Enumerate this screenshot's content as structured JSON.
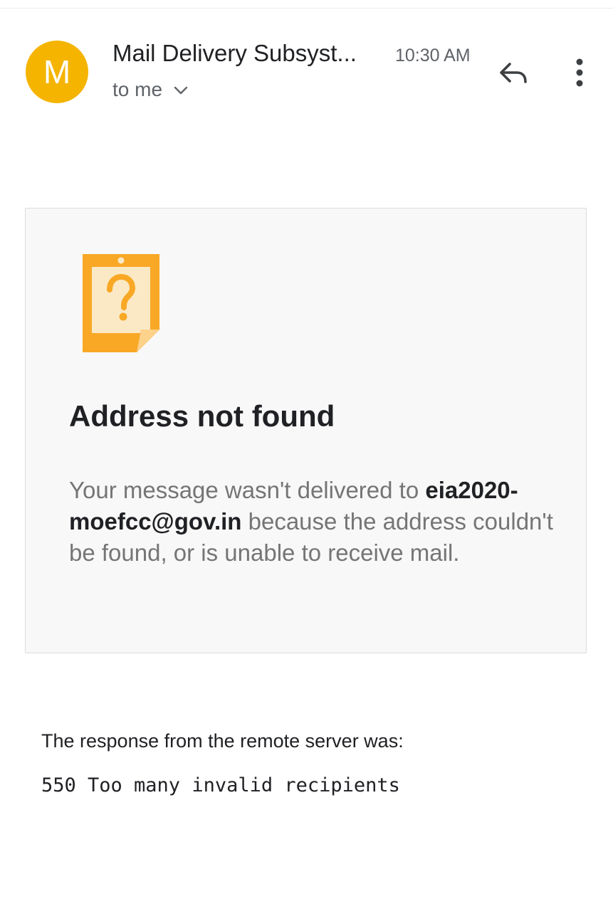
{
  "header": {
    "avatar_letter": "M",
    "avatar_color": "#f4b400",
    "sender": "Mail Delivery Subsyst...",
    "time": "10:30 AM",
    "recipient": "to me",
    "recipient_toggle_icon": "chevron-down-icon",
    "reply_icon": "reply-icon",
    "more_icon": "more-vert-icon"
  },
  "card": {
    "icon": "question-note-icon",
    "icon_color": "#f9a825",
    "title": "Address not found",
    "body_before": "Your message wasn't delivered to ",
    "address": "eia2020-moefcc@gov.in",
    "body_after": " because the address couldn't be found, or is unable to receive mail."
  },
  "response": {
    "label": "The response from the remote server was:",
    "code": "550 Too many invalid recipients"
  }
}
